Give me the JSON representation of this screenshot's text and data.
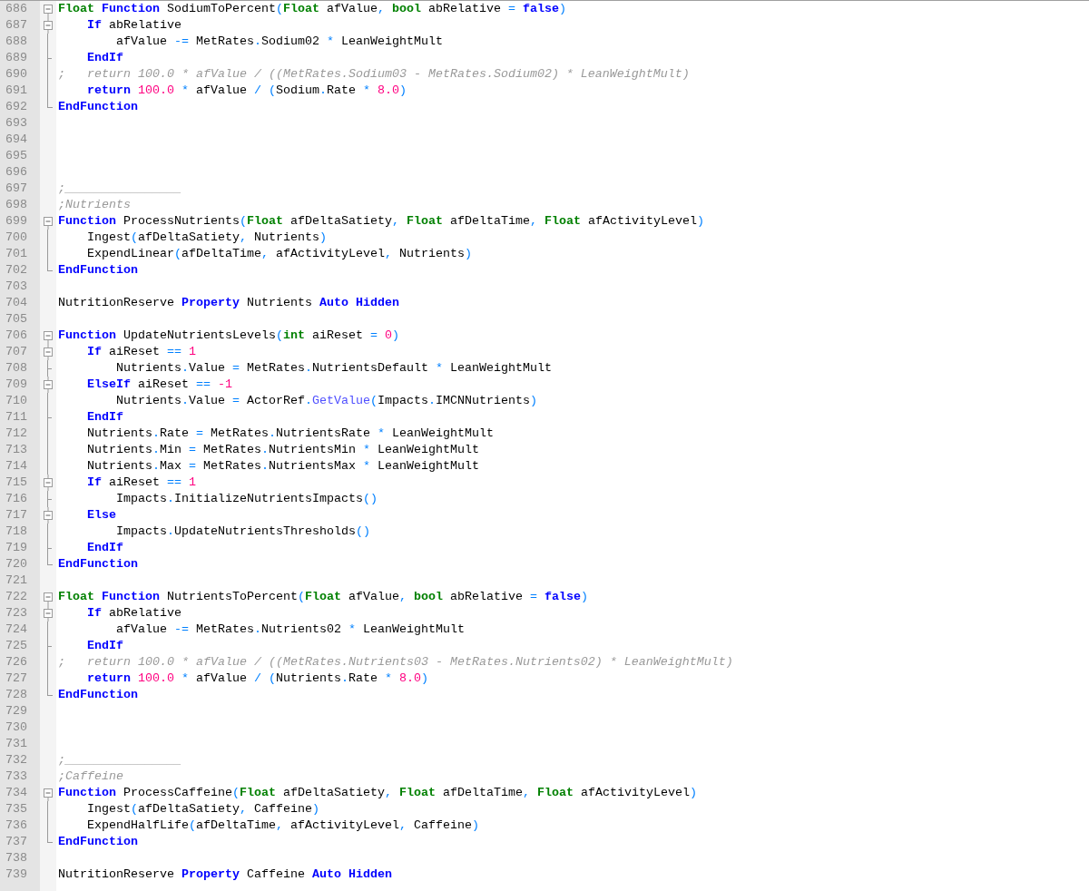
{
  "editor": {
    "lines": [
      {
        "number": "686",
        "kind": "open",
        "tokens": [
          {
            "kind": "type",
            "text": "Float "
          },
          {
            "kind": "kw",
            "text": "Function"
          },
          {
            "kind": "plain",
            "text": " SodiumToPercent"
          },
          {
            "kind": "op",
            "text": "("
          },
          {
            "kind": "type",
            "text": "Float"
          },
          {
            "kind": "plain",
            "text": " afValue"
          },
          {
            "kind": "op",
            "text": ", "
          },
          {
            "kind": "type",
            "text": "bool"
          },
          {
            "kind": "plain",
            "text": " abRelative "
          },
          {
            "kind": "op",
            "text": "= "
          },
          {
            "kind": "kw",
            "text": "false"
          },
          {
            "kind": "op",
            "text": ")"
          }
        ]
      },
      {
        "number": "687",
        "kind": "open-nested",
        "tokens": [
          {
            "kind": "kw",
            "text": "    If"
          },
          {
            "kind": "plain",
            "text": " abRelative"
          }
        ]
      },
      {
        "number": "688",
        "kind": "mid",
        "tokens": [
          {
            "kind": "plain",
            "text": "        afValue "
          },
          {
            "kind": "op",
            "text": "-="
          },
          {
            "kind": "plain",
            "text": " MetRates"
          },
          {
            "kind": "op",
            "text": "."
          },
          {
            "kind": "plain",
            "text": "Sodium02 "
          },
          {
            "kind": "op",
            "text": "*"
          },
          {
            "kind": "plain",
            "text": " LeanWeightMult"
          }
        ]
      },
      {
        "number": "689",
        "kind": "branch",
        "tokens": [
          {
            "kind": "kw",
            "text": "    EndIf"
          }
        ]
      },
      {
        "number": "690",
        "kind": "mid",
        "tokens": [
          {
            "kind": "comment",
            "text": ";   return 100.0 * afValue / ((MetRates.Sodium03 - MetRates.Sodium02) * LeanWeightMult)"
          }
        ]
      },
      {
        "number": "691",
        "kind": "mid",
        "tokens": [
          {
            "kind": "kw",
            "text": "    return "
          },
          {
            "kind": "num",
            "text": "100.0 "
          },
          {
            "kind": "op",
            "text": "*"
          },
          {
            "kind": "plain",
            "text": " afValue "
          },
          {
            "kind": "op",
            "text": "/ ("
          },
          {
            "kind": "plain",
            "text": "Sodium"
          },
          {
            "kind": "op",
            "text": "."
          },
          {
            "kind": "plain",
            "text": "Rate "
          },
          {
            "kind": "op",
            "text": "* "
          },
          {
            "kind": "num",
            "text": "8.0"
          },
          {
            "kind": "op",
            "text": ")"
          }
        ]
      },
      {
        "number": "692",
        "kind": "end",
        "tokens": [
          {
            "kind": "kw",
            "text": "EndFunction"
          }
        ]
      },
      {
        "number": "693"
      },
      {
        "number": "694"
      },
      {
        "number": "695"
      },
      {
        "number": "696"
      },
      {
        "number": "697",
        "tokens": [
          {
            "kind": "comment",
            "text": ";________________"
          }
        ]
      },
      {
        "number": "698",
        "tokens": [
          {
            "kind": "comment",
            "text": ";Nutrients"
          }
        ]
      },
      {
        "number": "699",
        "kind": "open",
        "tokens": [
          {
            "kind": "kw",
            "text": "Function"
          },
          {
            "kind": "plain",
            "text": " ProcessNutrients"
          },
          {
            "kind": "op",
            "text": "("
          },
          {
            "kind": "type",
            "text": "Float"
          },
          {
            "kind": "plain",
            "text": " afDeltaSatiety"
          },
          {
            "kind": "op",
            "text": ", "
          },
          {
            "kind": "type",
            "text": "Float"
          },
          {
            "kind": "plain",
            "text": " afDeltaTime"
          },
          {
            "kind": "op",
            "text": ", "
          },
          {
            "kind": "type",
            "text": "Float"
          },
          {
            "kind": "plain",
            "text": " afActivityLevel"
          },
          {
            "kind": "op",
            "text": ")"
          }
        ]
      },
      {
        "number": "700",
        "kind": "mid",
        "tokens": [
          {
            "kind": "plain",
            "text": "    Ingest"
          },
          {
            "kind": "op",
            "text": "("
          },
          {
            "kind": "plain",
            "text": "afDeltaSatiety"
          },
          {
            "kind": "op",
            "text": ","
          },
          {
            "kind": "plain",
            "text": " Nutrients"
          },
          {
            "kind": "op",
            "text": ")"
          }
        ]
      },
      {
        "number": "701",
        "kind": "mid",
        "tokens": [
          {
            "kind": "plain",
            "text": "    ExpendLinear"
          },
          {
            "kind": "op",
            "text": "("
          },
          {
            "kind": "plain",
            "text": "afDeltaTime"
          },
          {
            "kind": "op",
            "text": ","
          },
          {
            "kind": "plain",
            "text": " afActivityLevel"
          },
          {
            "kind": "op",
            "text": ","
          },
          {
            "kind": "plain",
            "text": " Nutrients"
          },
          {
            "kind": "op",
            "text": ")"
          }
        ]
      },
      {
        "number": "702",
        "kind": "end",
        "tokens": [
          {
            "kind": "kw",
            "text": "EndFunction"
          }
        ]
      },
      {
        "number": "703"
      },
      {
        "number": "704",
        "tokens": [
          {
            "kind": "plain",
            "text": "NutritionReserve "
          },
          {
            "kind": "kw",
            "text": "Property"
          },
          {
            "kind": "plain",
            "text": " Nutrients "
          },
          {
            "kind": "kw",
            "text": "Auto Hidden"
          }
        ]
      },
      {
        "number": "705"
      },
      {
        "number": "706",
        "kind": "open",
        "tokens": [
          {
            "kind": "kw",
            "text": "Function"
          },
          {
            "kind": "plain",
            "text": " UpdateNutrientsLevels"
          },
          {
            "kind": "op",
            "text": "("
          },
          {
            "kind": "type",
            "text": "int"
          },
          {
            "kind": "plain",
            "text": " aiReset "
          },
          {
            "kind": "op",
            "text": "= "
          },
          {
            "kind": "num",
            "text": "0"
          },
          {
            "kind": "op",
            "text": ")"
          }
        ]
      },
      {
        "number": "707",
        "kind": "open-nested",
        "tokens": [
          {
            "kind": "kw",
            "text": "    If"
          },
          {
            "kind": "plain",
            "text": " aiReset "
          },
          {
            "kind": "op",
            "text": "== "
          },
          {
            "kind": "num",
            "text": "1"
          }
        ]
      },
      {
        "number": "708",
        "kind": "branch",
        "tokens": [
          {
            "kind": "plain",
            "text": "        Nutrients"
          },
          {
            "kind": "op",
            "text": "."
          },
          {
            "kind": "plain",
            "text": "Value "
          },
          {
            "kind": "op",
            "text": "="
          },
          {
            "kind": "plain",
            "text": " MetRates"
          },
          {
            "kind": "op",
            "text": "."
          },
          {
            "kind": "plain",
            "text": "NutrientsDefault "
          },
          {
            "kind": "op",
            "text": "*"
          },
          {
            "kind": "plain",
            "text": " LeanWeightMult"
          }
        ]
      },
      {
        "number": "709",
        "kind": "open-nested",
        "tokens": [
          {
            "kind": "kw",
            "text": "    ElseIf"
          },
          {
            "kind": "plain",
            "text": " aiReset "
          },
          {
            "kind": "op",
            "text": "== "
          },
          {
            "kind": "num",
            "text": "-1"
          }
        ]
      },
      {
        "number": "710",
        "kind": "mid",
        "tokens": [
          {
            "kind": "plain",
            "text": "        Nutrients"
          },
          {
            "kind": "op",
            "text": "."
          },
          {
            "kind": "plain",
            "text": "Value "
          },
          {
            "kind": "op",
            "text": "="
          },
          {
            "kind": "plain",
            "text": " ActorRef"
          },
          {
            "kind": "op",
            "text": "."
          },
          {
            "kind": "call",
            "text": "GetValue"
          },
          {
            "kind": "op",
            "text": "("
          },
          {
            "kind": "plain",
            "text": "Impacts"
          },
          {
            "kind": "op",
            "text": "."
          },
          {
            "kind": "plain",
            "text": "IMCNNutrients"
          },
          {
            "kind": "op",
            "text": ")"
          }
        ]
      },
      {
        "number": "711",
        "kind": "branch",
        "tokens": [
          {
            "kind": "kw",
            "text": "    EndIf"
          }
        ]
      },
      {
        "number": "712",
        "kind": "mid",
        "tokens": [
          {
            "kind": "plain",
            "text": "    Nutrients"
          },
          {
            "kind": "op",
            "text": "."
          },
          {
            "kind": "plain",
            "text": "Rate "
          },
          {
            "kind": "op",
            "text": "="
          },
          {
            "kind": "plain",
            "text": " MetRates"
          },
          {
            "kind": "op",
            "text": "."
          },
          {
            "kind": "plain",
            "text": "NutrientsRate "
          },
          {
            "kind": "op",
            "text": "*"
          },
          {
            "kind": "plain",
            "text": " LeanWeightMult"
          }
        ]
      },
      {
        "number": "713",
        "kind": "mid",
        "tokens": [
          {
            "kind": "plain",
            "text": "    Nutrients"
          },
          {
            "kind": "op",
            "text": "."
          },
          {
            "kind": "plain",
            "text": "Min "
          },
          {
            "kind": "op",
            "text": "="
          },
          {
            "kind": "plain",
            "text": " MetRates"
          },
          {
            "kind": "op",
            "text": "."
          },
          {
            "kind": "plain",
            "text": "NutrientsMin "
          },
          {
            "kind": "op",
            "text": "*"
          },
          {
            "kind": "plain",
            "text": " LeanWeightMult"
          }
        ]
      },
      {
        "number": "714",
        "kind": "mid",
        "tokens": [
          {
            "kind": "plain",
            "text": "    Nutrients"
          },
          {
            "kind": "op",
            "text": "."
          },
          {
            "kind": "plain",
            "text": "Max "
          },
          {
            "kind": "op",
            "text": "="
          },
          {
            "kind": "plain",
            "text": " MetRates"
          },
          {
            "kind": "op",
            "text": "."
          },
          {
            "kind": "plain",
            "text": "NutrientsMax "
          },
          {
            "kind": "op",
            "text": "*"
          },
          {
            "kind": "plain",
            "text": " LeanWeightMult"
          }
        ]
      },
      {
        "number": "715",
        "kind": "open-nested",
        "tokens": [
          {
            "kind": "kw",
            "text": "    If"
          },
          {
            "kind": "plain",
            "text": " aiReset "
          },
          {
            "kind": "op",
            "text": "== "
          },
          {
            "kind": "num",
            "text": "1"
          }
        ]
      },
      {
        "number": "716",
        "kind": "branch",
        "tokens": [
          {
            "kind": "plain",
            "text": "        Impacts"
          },
          {
            "kind": "op",
            "text": "."
          },
          {
            "kind": "plain",
            "text": "InitializeNutrientsImpacts"
          },
          {
            "kind": "op",
            "text": "()"
          }
        ]
      },
      {
        "number": "717",
        "kind": "open-nested",
        "tokens": [
          {
            "kind": "kw",
            "text": "    Else"
          }
        ]
      },
      {
        "number": "718",
        "kind": "mid",
        "tokens": [
          {
            "kind": "plain",
            "text": "        Impacts"
          },
          {
            "kind": "op",
            "text": "."
          },
          {
            "kind": "plain",
            "text": "UpdateNutrientsThresholds"
          },
          {
            "kind": "op",
            "text": "()"
          }
        ]
      },
      {
        "number": "719",
        "kind": "branch",
        "tokens": [
          {
            "kind": "kw",
            "text": "    EndIf"
          }
        ]
      },
      {
        "number": "720",
        "kind": "end",
        "tokens": [
          {
            "kind": "kw",
            "text": "EndFunction"
          }
        ]
      },
      {
        "number": "721"
      },
      {
        "number": "722",
        "kind": "open",
        "tokens": [
          {
            "kind": "type",
            "text": "Float "
          },
          {
            "kind": "kw",
            "text": "Function"
          },
          {
            "kind": "plain",
            "text": " NutrientsToPercent"
          },
          {
            "kind": "op",
            "text": "("
          },
          {
            "kind": "type",
            "text": "Float"
          },
          {
            "kind": "plain",
            "text": " afValue"
          },
          {
            "kind": "op",
            "text": ", "
          },
          {
            "kind": "type",
            "text": "bool"
          },
          {
            "kind": "plain",
            "text": " abRelative "
          },
          {
            "kind": "op",
            "text": "= "
          },
          {
            "kind": "kw",
            "text": "false"
          },
          {
            "kind": "op",
            "text": ")"
          }
        ]
      },
      {
        "number": "723",
        "kind": "open-nested",
        "tokens": [
          {
            "kind": "kw",
            "text": "    If"
          },
          {
            "kind": "plain",
            "text": " abRelative"
          }
        ]
      },
      {
        "number": "724",
        "kind": "mid",
        "tokens": [
          {
            "kind": "plain",
            "text": "        afValue "
          },
          {
            "kind": "op",
            "text": "-="
          },
          {
            "kind": "plain",
            "text": " MetRates"
          },
          {
            "kind": "op",
            "text": "."
          },
          {
            "kind": "plain",
            "text": "Nutrients02 "
          },
          {
            "kind": "op",
            "text": "*"
          },
          {
            "kind": "plain",
            "text": " LeanWeightMult"
          }
        ]
      },
      {
        "number": "725",
        "kind": "branch",
        "tokens": [
          {
            "kind": "kw",
            "text": "    EndIf"
          }
        ]
      },
      {
        "number": "726",
        "kind": "mid",
        "tokens": [
          {
            "kind": "comment",
            "text": ";   return 100.0 * afValue / ((MetRates.Nutrients03 - MetRates.Nutrients02) * LeanWeightMult)"
          }
        ]
      },
      {
        "number": "727",
        "kind": "mid",
        "tokens": [
          {
            "kind": "kw",
            "text": "    return "
          },
          {
            "kind": "num",
            "text": "100.0 "
          },
          {
            "kind": "op",
            "text": "*"
          },
          {
            "kind": "plain",
            "text": " afValue "
          },
          {
            "kind": "op",
            "text": "/ ("
          },
          {
            "kind": "plain",
            "text": "Nutrients"
          },
          {
            "kind": "op",
            "text": "."
          },
          {
            "kind": "plain",
            "text": "Rate "
          },
          {
            "kind": "op",
            "text": "* "
          },
          {
            "kind": "num",
            "text": "8.0"
          },
          {
            "kind": "op",
            "text": ")"
          }
        ]
      },
      {
        "number": "728",
        "kind": "end",
        "tokens": [
          {
            "kind": "kw",
            "text": "EndFunction"
          }
        ]
      },
      {
        "number": "729"
      },
      {
        "number": "730"
      },
      {
        "number": "731"
      },
      {
        "number": "732",
        "tokens": [
          {
            "kind": "comment",
            "text": ";________________"
          }
        ]
      },
      {
        "number": "733",
        "tokens": [
          {
            "kind": "comment",
            "text": ";Caffeine"
          }
        ]
      },
      {
        "number": "734",
        "kind": "open",
        "tokens": [
          {
            "kind": "kw",
            "text": "Function"
          },
          {
            "kind": "plain",
            "text": " ProcessCaffeine"
          },
          {
            "kind": "op",
            "text": "("
          },
          {
            "kind": "type",
            "text": "Float"
          },
          {
            "kind": "plain",
            "text": " afDeltaSatiety"
          },
          {
            "kind": "op",
            "text": ", "
          },
          {
            "kind": "type",
            "text": "Float"
          },
          {
            "kind": "plain",
            "text": " afDeltaTime"
          },
          {
            "kind": "op",
            "text": ", "
          },
          {
            "kind": "type",
            "text": "Float"
          },
          {
            "kind": "plain",
            "text": " afActivityLevel"
          },
          {
            "kind": "op",
            "text": ")"
          }
        ]
      },
      {
        "number": "735",
        "kind": "mid",
        "tokens": [
          {
            "kind": "plain",
            "text": "    Ingest"
          },
          {
            "kind": "op",
            "text": "("
          },
          {
            "kind": "plain",
            "text": "afDeltaSatiety"
          },
          {
            "kind": "op",
            "text": ","
          },
          {
            "kind": "plain",
            "text": " Caffeine"
          },
          {
            "kind": "op",
            "text": ")"
          }
        ]
      },
      {
        "number": "736",
        "kind": "mid",
        "tokens": [
          {
            "kind": "plain",
            "text": "    ExpendHalfLife"
          },
          {
            "kind": "op",
            "text": "("
          },
          {
            "kind": "plain",
            "text": "afDeltaTime"
          },
          {
            "kind": "op",
            "text": ","
          },
          {
            "kind": "plain",
            "text": " afActivityLevel"
          },
          {
            "kind": "op",
            "text": ","
          },
          {
            "kind": "plain",
            "text": " Caffeine"
          },
          {
            "kind": "op",
            "text": ")"
          }
        ]
      },
      {
        "number": "737",
        "kind": "end",
        "tokens": [
          {
            "kind": "kw",
            "text": "EndFunction"
          }
        ]
      },
      {
        "number": "738"
      },
      {
        "number": "739",
        "tokens": [
          {
            "kind": "plain",
            "text": "NutritionReserve "
          },
          {
            "kind": "kw",
            "text": "Property"
          },
          {
            "kind": "plain",
            "text": " Caffeine "
          },
          {
            "kind": "kw",
            "text": "Auto Hidden"
          }
        ]
      }
    ]
  }
}
